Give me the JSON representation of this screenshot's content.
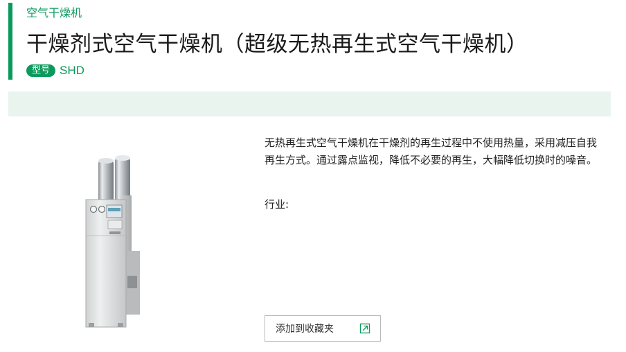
{
  "breadcrumb": {
    "category": "空气干燥机"
  },
  "header": {
    "title": "干燥剂式空气干燥机（超级无热再生式空气干燥机）",
    "model_badge": "型号",
    "model_value": "SHD"
  },
  "product": {
    "image_icon": "dryer-unit-image",
    "description": "无热再生式空气干燥机在干燥剂的再生过程中不使用热量，采用减压自我再生方式。通过露点监视，降低不必要的再生，大幅降低切换时的噪音。",
    "industry_label": "行业:"
  },
  "actions": {
    "favorite_label": "添加到收藏夹",
    "favorite_icon": "external-link-icon"
  },
  "colors": {
    "accent": "#0a9a5c",
    "band": "#eaf4ef",
    "button_border": "#b8b8b8"
  }
}
